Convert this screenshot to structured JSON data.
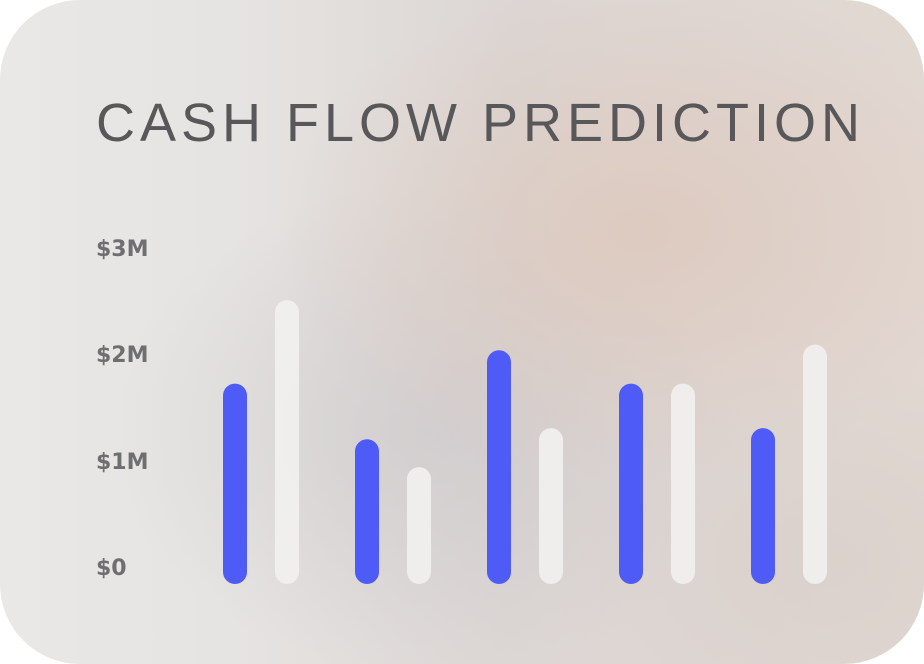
{
  "chart_data": {
    "type": "bar",
    "title": "CASH FLOW PREDICTION",
    "xlabel": "",
    "ylabel": "",
    "y_tick_labels": [
      "$0",
      "$1M",
      "$2M",
      "$3M"
    ],
    "y_tick_values": [
      0,
      1,
      2,
      3
    ],
    "ylim": [
      0,
      3
    ],
    "unit": "$M",
    "grid": false,
    "categories": [
      "",
      "",
      "",
      "",
      ""
    ],
    "series": [
      {
        "values": [
          1.8,
          1.3,
          2.1,
          1.8,
          1.4
        ],
        "color": "#4f5bf7"
      },
      {
        "values": [
          2.55,
          1.05,
          1.4,
          1.8,
          2.15
        ],
        "color": "#f2f1f0"
      }
    ]
  }
}
